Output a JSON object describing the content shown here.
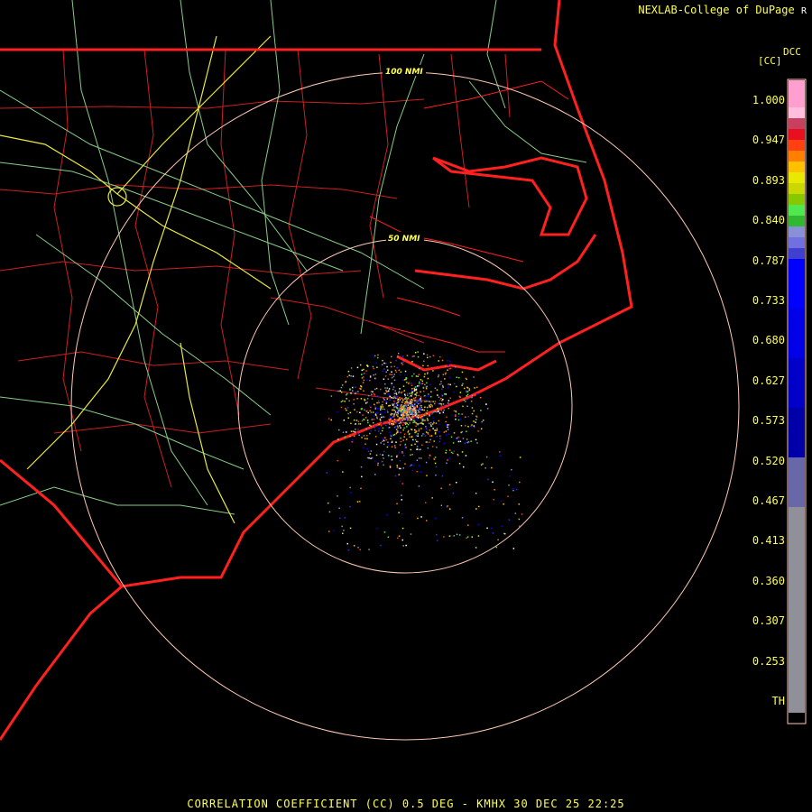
{
  "header": {
    "source": "NEXLAB-College of DuPage",
    "mark": "R"
  },
  "colorbar": {
    "product": "DCC",
    "unit": "[CC]",
    "ticks": [
      "1.000",
      "0.947",
      "0.893",
      "0.840",
      "0.787",
      "0.733",
      "0.680",
      "0.627",
      "0.573",
      "0.520",
      "0.467",
      "0.413",
      "0.360",
      "0.307",
      "0.253",
      "TH"
    ],
    "colors": [
      "#ff9fd0",
      "#ffbedd",
      "#c84060",
      "#e81020",
      "#ff4010",
      "#ff8000",
      "#ffc000",
      "#e8e800",
      "#c8d800",
      "#88c800",
      "#50e850",
      "#30b830",
      "#8890d8",
      "#7070e0",
      "#4040d0",
      "#0000ff",
      "#0000e8",
      "#0000c8",
      "#0000a8",
      "#6868a8",
      "#909098"
    ],
    "icon": "color-scale-bar"
  },
  "range_rings": [
    {
      "label": "50 NMI"
    },
    {
      "label": "100 NMI"
    }
  ],
  "footer": "CORRELATION COEFFICIENT (CC) 0.5 DEG - KMHX 30 DEC 25 22:25",
  "colors": {
    "state_line": "#ff2020",
    "county_line": "#cc2020",
    "road": "#88cc88",
    "interstate": "#e8e840",
    "ring": "#ffc8b4",
    "text": "#ffff55"
  }
}
